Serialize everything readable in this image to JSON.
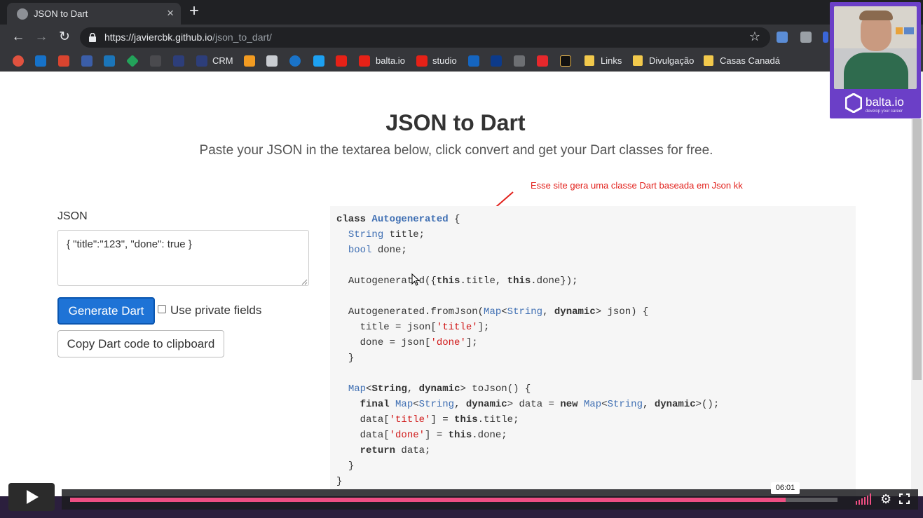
{
  "browser": {
    "tab_title": "JSON to Dart",
    "tab_close": "×",
    "new_tab": "+",
    "url_host": "https://javiercbk.github.io",
    "url_path": "/json_to_dart/",
    "back": "←",
    "forward": "→",
    "reload": "↻",
    "star": "☆"
  },
  "bookmarks": [
    {
      "label": "CRM"
    },
    {
      "label": "balta.io"
    },
    {
      "label": "studio"
    },
    {
      "label": "Links"
    },
    {
      "label": "Divulgação"
    },
    {
      "label": "Casas Canadá"
    }
  ],
  "page": {
    "title": "JSON to Dart",
    "subtitle": "Paste your JSON in the textarea below, click convert and get your Dart classes for free.",
    "annotation": "Esse site gera uma classe Dart baseada em Json kk",
    "json_label": "JSON",
    "json_value": "{ \"title\":\"123\", \"done\": true }",
    "generate_button": "Generate Dart",
    "private_fields_label": "Use private fields",
    "private_fields_checked": false,
    "copy_button": "Copy Dart code to clipboard"
  },
  "code": {
    "class_kw": "class",
    "class_name": "Autogenerated",
    "brace_open": " {",
    "field1_type": "String",
    "field1_name": " title;",
    "field2_type": "bool",
    "field2_name": " done;",
    "ctor_name": "Autogenerated({",
    "this_kw": "this",
    "ctor_title": ".title, ",
    "ctor_done": ".done});",
    "fromjson_prefix": "Autogenerated.fromJson(",
    "map_type": "Map",
    "lt": "<",
    "string_type": "String",
    "comma": ", ",
    "dynamic_kw": "dynamic",
    "fromjson_suffix": "> json) {",
    "assign_title_prefix": "title = json[",
    "str_title": "'title'",
    "assign_suffix": "];",
    "assign_done_prefix": "done = json[",
    "str_done": "'done'",
    "close_brace": "}",
    "tojson_suffix": "> toJson() {",
    "final_kw": "final",
    "data_eq": "> data = ",
    "new_kw": "new",
    "end_new": ">();",
    "data_open": "data[",
    "eq_this": "] = ",
    "dot_title": ".title;",
    "dot_done": ".done;",
    "return_kw": "return",
    "return_rest": " data;"
  },
  "webcam": {
    "brand": "balta.io",
    "tagline": "develop your career"
  },
  "player": {
    "time_tooltip": "06:01",
    "progress": 0.932,
    "settings_glyph": "⚙"
  },
  "colors": {
    "accent_button": "#1e73d6",
    "code_type": "#3f6fb3",
    "code_string": "#d01a1a",
    "annotation": "#e2211c",
    "progress": "#ef4f83",
    "webcam_frame": "#6b3fc7"
  }
}
